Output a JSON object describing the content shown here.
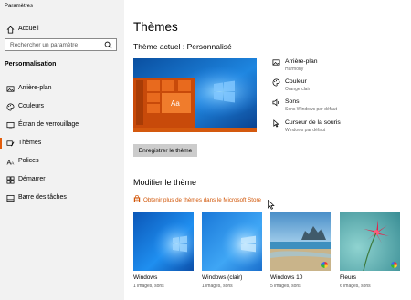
{
  "window": {
    "title": "Paramètres"
  },
  "sidebar": {
    "home": "Accueil",
    "search_placeholder": "Rechercher un paramètre",
    "section": "Personnalisation",
    "items": [
      {
        "label": "Arrière-plan",
        "icon": "image-icon"
      },
      {
        "label": "Couleurs",
        "icon": "palette-icon"
      },
      {
        "label": "Écran de verrouillage",
        "icon": "lock-screen-icon"
      },
      {
        "label": "Thèmes",
        "icon": "brush-icon",
        "active": true
      },
      {
        "label": "Polices",
        "icon": "font-icon"
      },
      {
        "label": "Démarrer",
        "icon": "start-icon"
      },
      {
        "label": "Barre des tâches",
        "icon": "taskbar-icon"
      }
    ]
  },
  "main": {
    "title": "Thèmes",
    "current_theme": "Thème actuel : Personnalisé",
    "properties": [
      {
        "title": "Arrière-plan",
        "subtitle": "Harmony",
        "icon": "image-icon"
      },
      {
        "title": "Couleur",
        "subtitle": "Orange clair",
        "icon": "palette-icon"
      },
      {
        "title": "Sons",
        "subtitle": "Sons Windows par défaut",
        "icon": "speaker-icon"
      },
      {
        "title": "Curseur de la souris",
        "subtitle": "Windows par défaut",
        "icon": "cursor-icon"
      }
    ],
    "preview_tile_text": "Aa",
    "save_button": "Enregistrer le thème",
    "modify_heading": "Modifier le thème",
    "store_link": "Obtenir plus de thèmes dans le Microsoft Store",
    "themes": [
      {
        "name": "Windows",
        "subtitle": "1 images, sons"
      },
      {
        "name": "Windows (clair)",
        "subtitle": "1 images, sons"
      },
      {
        "name": "Windows 10",
        "subtitle": "5 images, sons"
      },
      {
        "name": "Fleurs",
        "subtitle": "6 images, sons"
      }
    ]
  },
  "colors": {
    "accent": "#e35d0c",
    "link": "#d15405",
    "preview_orange": "#e35d0c"
  }
}
